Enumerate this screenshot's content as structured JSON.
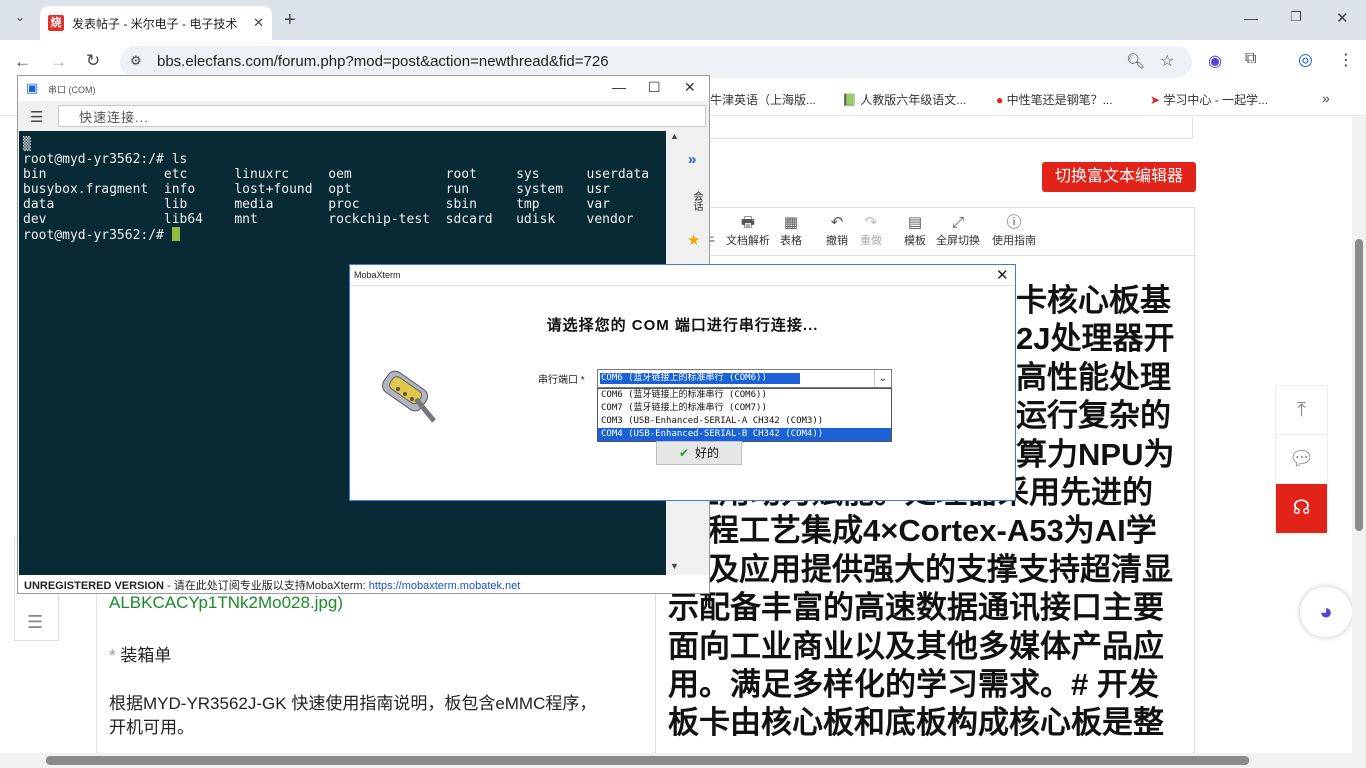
{
  "browser": {
    "tab_title": "发表帖子 - 米尔电子 - 电子技术",
    "tab_favicon_text": "烧",
    "new_tab_symbol": "+",
    "url": "bbs.elecfans.com/forum.php?mod=post&action=newthread&fid=726",
    "bookmarks": [
      "牛津英语（上海版...",
      "人教版六年级语文...",
      "中性笔还是钢笔？...",
      "学习中心 - 一起学..."
    ]
  },
  "page": {
    "switch_editor_label": "切换富文本编辑器",
    "editor_toolbar": [
      {
        "icon": "doc-parse-icon",
        "label": "文档解析"
      },
      {
        "icon": "table-icon",
        "label": "表格"
      },
      {
        "icon": "undo-icon",
        "label": "撤销"
      },
      {
        "icon": "redo-icon",
        "label": "重做"
      },
      {
        "icon": "template-icon",
        "label": "模板"
      },
      {
        "icon": "fullscreen-icon",
        "label": "全屏切换"
      },
      {
        "icon": "help-icon",
        "label": "使用指南"
      }
    ],
    "editor_partial_label": "牛",
    "big_text_lines": [
      "卡核心板基",
      "2J处理器开",
      "高性能处理",
      "运行复杂的",
      "算力NPU为",
      "应用动力赋能。处理器采用先进的",
      "程工艺集成4×Cortex-A53为AI学",
      "及应用提供强大的支撑支持超清显",
      "示配备丰富的高速数据通讯接口主要",
      "面向工业商业以及其他多媒体产品应",
      "用。满足多样化的学习需求。# 开发",
      "板卡由核心板和底板构成核心板是整"
    ],
    "left_content": {
      "image_ref": "ALBKCACYp1TNk2Mo028.jpg)",
      "packing_list_bullet": "*",
      "packing_list": "装箱单",
      "note_line1": "根据MYD-YR3562J-GK 快速使用指南说明，板包含eMMC程序，",
      "note_line2": "开机可用。"
    }
  },
  "mobaxterm": {
    "window_title": "串口 (COM)",
    "quick_connect_placeholder": "快速连接...",
    "side_tab_label": "会话",
    "terminal_lines": [
      "▒",
      "root@myd-yr3562:/# ls",
      "bin               etc      linuxrc     oem            root     sys      userdata",
      "busybox.fragment  info     lost+found  opt            run      system   usr",
      "data              lib      media       proc           sbin     tmp      var",
      "dev               lib64    mnt         rockchip-test  sdcard   udisk    vendor",
      "root@myd-yr3562:/# "
    ],
    "status_unregistered": "UNREGISTERED VERSION",
    "status_text": " - 请在此处订阅专业版以支持MobaXterm: ",
    "status_link": "https://mobaxterm.mobatek.net"
  },
  "dialog": {
    "title": "MobaXterm",
    "heading": "请选择您的 COM 端口进行串行连接...",
    "port_label": "串行端口 *",
    "selected": "COM6  (蓝牙链接上的标准串行 (COM6))",
    "options": [
      "COM6  (蓝牙链接上的标准串行 (COM6))",
      "COM7  (蓝牙链接上的标准串行 (COM7))",
      "COM3  (USB-Enhanced-SERIAL-A CH342 (COM3))",
      "COM4  (USB-Enhanced-SERIAL-B CH342 (COM4))"
    ],
    "highlighted_option_index": 3,
    "ok_label": "好的",
    "colors": {
      "selection": "#1a62d6",
      "terminal_bg": "#082a34",
      "accent_red": "#e1231a"
    }
  }
}
